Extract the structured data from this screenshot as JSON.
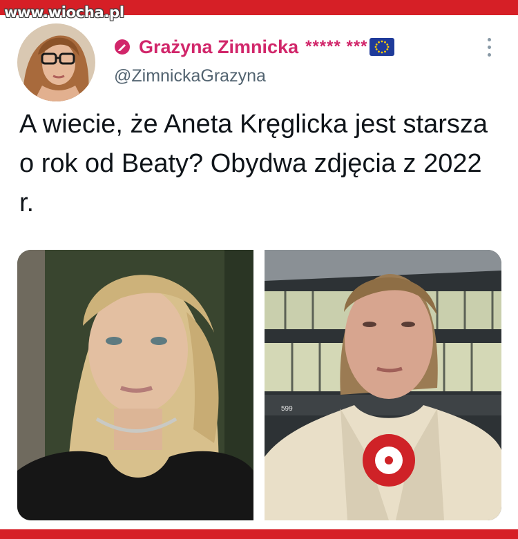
{
  "watermark": "www.wiocha.pl",
  "tweet": {
    "display_name": "Grażyna Zimnicka",
    "name_suffix": "***** ***",
    "handle": "@ZimnickaGrazyna",
    "text": "A wiecie, że Aneta Kręglicka jest starsza o rok od Beaty? Obydwa zdjęcia z 2022 r.",
    "media_right_number": "599"
  },
  "icons": {
    "verified": "verified-badge-icon",
    "flag": "eu-flag-icon",
    "more": "more-options-icon"
  },
  "colors": {
    "brand_red": "#d61f26",
    "name_pink": "#d1266a",
    "handle_gray": "#536471",
    "text": "#0f1419"
  }
}
